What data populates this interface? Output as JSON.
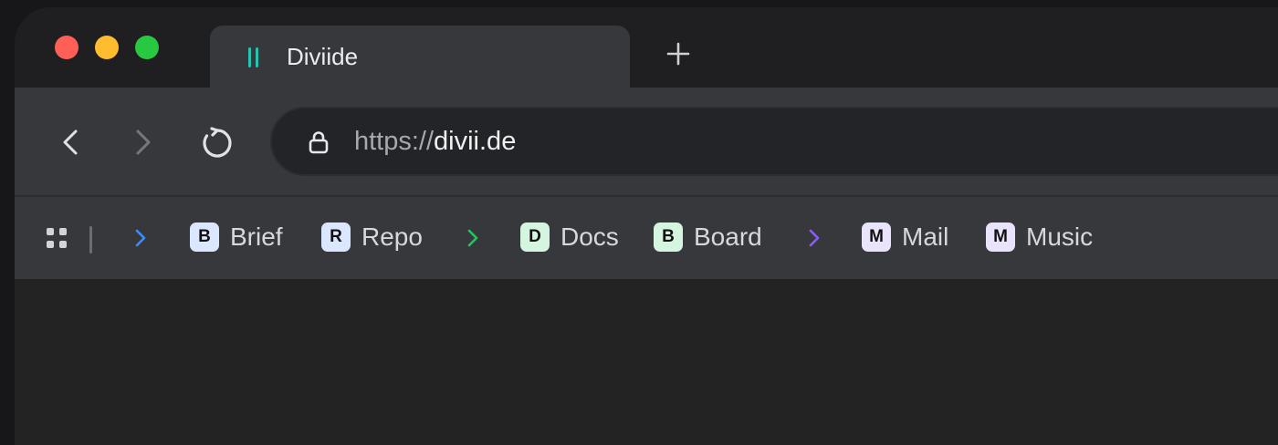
{
  "window": {
    "traffic_lights": {
      "close_color": "#fe5f57",
      "minimize_color": "#febc2e",
      "zoom_color": "#28c840"
    }
  },
  "tab": {
    "title": "Diviide",
    "icon": "divider-bars-icon",
    "icon_color": "#23c4b0"
  },
  "new_tab": {
    "icon": "plus-icon"
  },
  "nav": {
    "back_icon": "chevron-left-icon",
    "forward_icon": "chevron-right-icon",
    "reload_icon": "reload-icon"
  },
  "address": {
    "lock_icon": "lock-icon",
    "scheme": "https://",
    "host": "divii.de"
  },
  "bookmarks": {
    "apps_icon": "apps-grid-icon",
    "groups": [
      {
        "chevron_color": "#3d8bff",
        "items": [
          {
            "letter": "B",
            "label": "Brief",
            "badge_color": "#dbe7ff"
          },
          {
            "letter": "R",
            "label": "Repo",
            "badge_color": "#dbe7ff"
          }
        ]
      },
      {
        "chevron_color": "#22c55e",
        "items": [
          {
            "letter": "D",
            "label": "Docs",
            "badge_color": "#d6f5e1"
          },
          {
            "letter": "B",
            "label": "Board",
            "badge_color": "#d6f5e1"
          }
        ]
      },
      {
        "chevron_color": "#8b5cf6",
        "items": [
          {
            "letter": "M",
            "label": "Mail",
            "badge_color": "#e9e3fb"
          },
          {
            "letter": "M",
            "label": "Music",
            "badge_color": "#e9e3fb"
          }
        ]
      }
    ]
  }
}
